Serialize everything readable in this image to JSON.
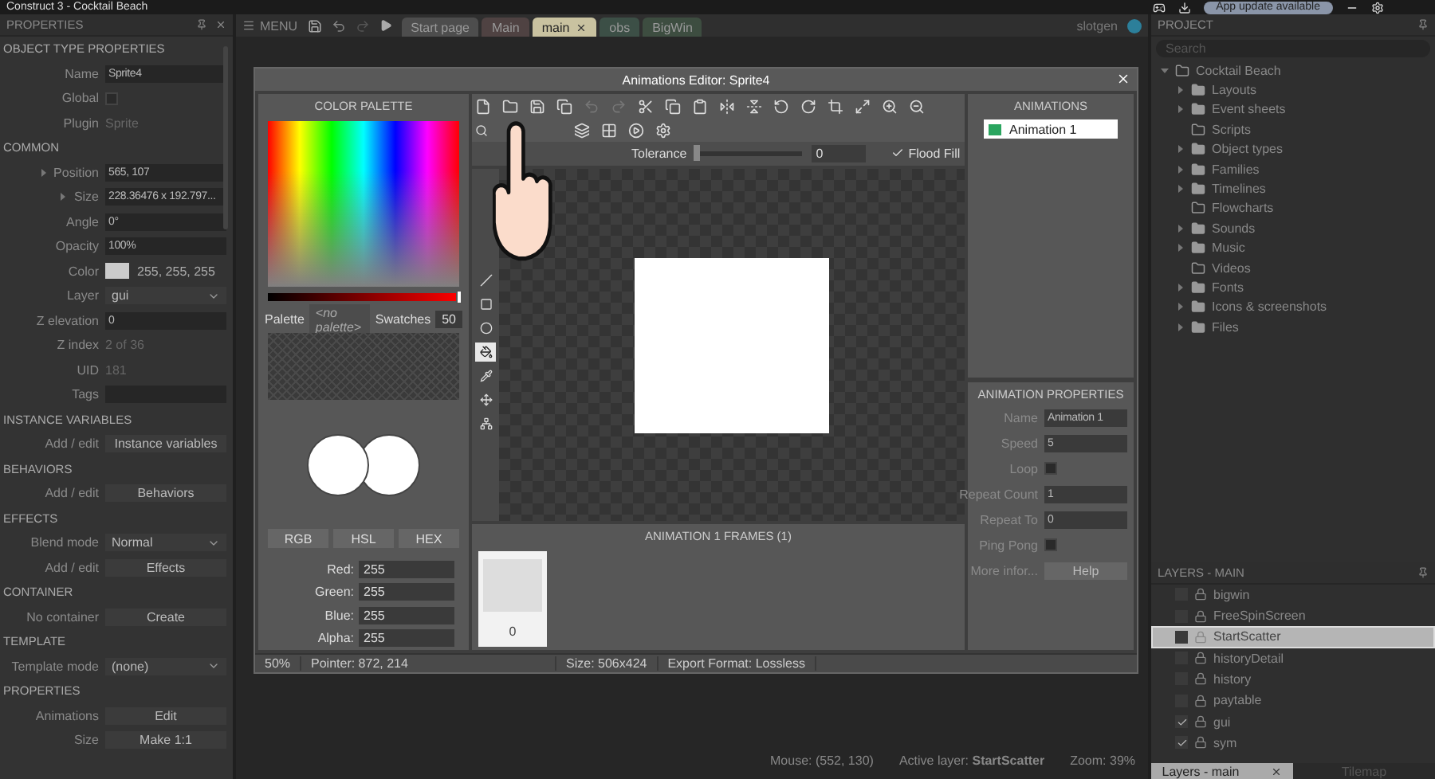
{
  "window": {
    "title": "Construct 3 - Cocktail Beach",
    "update_badge": "App update available"
  },
  "properties": {
    "title": "PROPERTIES",
    "sections": [
      {
        "title": "OBJECT TYPE PROPERTIES",
        "rows": [
          {
            "label": "Name",
            "kind": "input",
            "value": "Sprite4"
          },
          {
            "label": "Global",
            "kind": "checkbox",
            "checked": false
          },
          {
            "label": "Plugin",
            "kind": "text",
            "value": "Sprite"
          }
        ]
      },
      {
        "title": "COMMON",
        "rows": [
          {
            "label": "Position",
            "kind": "expand-input",
            "value": "565, 107"
          },
          {
            "label": "Size",
            "kind": "expand-input",
            "value": "228.36476 x 192.797..."
          },
          {
            "label": "Angle",
            "kind": "input",
            "value": "0°"
          },
          {
            "label": "Opacity",
            "kind": "input",
            "value": "100%"
          },
          {
            "label": "Color",
            "kind": "color",
            "value": "255, 255, 255"
          },
          {
            "label": "Layer",
            "kind": "select",
            "value": "gui"
          },
          {
            "label": "Z elevation",
            "kind": "input",
            "value": "0"
          },
          {
            "label": "Z index",
            "kind": "text",
            "value": "2 of 36"
          },
          {
            "label": "UID",
            "kind": "text",
            "value": "181"
          },
          {
            "label": "Tags",
            "kind": "input"
          }
        ]
      },
      {
        "title": "INSTANCE VARIABLES",
        "rows": [
          {
            "label": "Add / edit",
            "kind": "button",
            "value": "Instance variables"
          }
        ]
      },
      {
        "title": "BEHAVIORS",
        "rows": [
          {
            "label": "Add / edit",
            "kind": "button",
            "value": "Behaviors"
          }
        ]
      },
      {
        "title": "EFFECTS",
        "rows": [
          {
            "label": "Blend mode",
            "kind": "select",
            "value": "Normal"
          },
          {
            "label": "Add / edit",
            "kind": "button",
            "value": "Effects"
          }
        ]
      },
      {
        "title": "CONTAINER",
        "rows": [
          {
            "label": "No container",
            "kind": "button",
            "value": "Create"
          }
        ]
      },
      {
        "title": "TEMPLATE",
        "rows": [
          {
            "label": "Template mode",
            "kind": "select",
            "value": "(none)"
          }
        ]
      },
      {
        "title": "PROPERTIES",
        "rows": [
          {
            "label": "Animations",
            "kind": "button",
            "value": "Edit"
          },
          {
            "label": "Size",
            "kind": "button",
            "value": "Make 1:1"
          }
        ]
      }
    ]
  },
  "toolbar": {
    "menu": "MENU",
    "user": "slotgen"
  },
  "tabs": [
    {
      "label": "Start page",
      "selected": false,
      "color": "#4d4d4d"
    },
    {
      "label": "Main",
      "selected": false,
      "color": "#4f4242"
    },
    {
      "label": "main",
      "selected": true,
      "color": "#c9c2a0"
    },
    {
      "label": "obs",
      "selected": false,
      "color": "#3c4f46"
    },
    {
      "label": "BigWin",
      "selected": false,
      "color": "#3d4d40"
    }
  ],
  "editor": {
    "title": "Animations Editor: Sprite4",
    "palette": {
      "title": "COLOR PALETTE",
      "level": 1,
      "palette_label": "Palette",
      "palette_value": "<no palette>",
      "swatches_label": "Swatches",
      "swatches": "50",
      "modes": [
        "RGB",
        "HSL",
        "HEX"
      ],
      "channels": [
        {
          "label": "Red:",
          "value": "255"
        },
        {
          "label": "Green:",
          "value": "255"
        },
        {
          "label": "Blue:",
          "value": "255"
        },
        {
          "label": "Alpha:",
          "value": "255"
        }
      ]
    },
    "tolerance": {
      "label": "Tolerance",
      "value": "0",
      "level": 0
    },
    "flood_fill": {
      "label": "Flood Fill",
      "checked": true
    },
    "tools": [
      {
        "selected": false
      },
      {
        "selected": false
      },
      {
        "selected": false
      },
      {
        "selected": true
      },
      {
        "selected": false
      },
      {
        "selected": false
      },
      {
        "selected": false
      }
    ],
    "animations": {
      "title": "ANIMATIONS",
      "items": [
        {
          "name": "Animation 1",
          "selected": true
        }
      ]
    },
    "frames": {
      "title": "ANIMATION 1 FRAMES (1)",
      "items": [
        {
          "label": "0",
          "selected": true
        }
      ]
    },
    "animation_properties": {
      "title": "ANIMATION PROPERTIES",
      "rows": [
        {
          "label": "Name",
          "kind": "input",
          "value": "Animation 1"
        },
        {
          "label": "Speed",
          "kind": "input",
          "value": "5"
        },
        {
          "label": "Loop",
          "kind": "checkbox",
          "checked": false
        },
        {
          "label": "Repeat Count",
          "kind": "input",
          "value": "1"
        },
        {
          "label": "Repeat To",
          "kind": "input",
          "value": "0"
        },
        {
          "label": "Ping Pong",
          "kind": "checkbox",
          "checked": false
        },
        {
          "label": "More infor...",
          "kind": "button",
          "value": "Help"
        }
      ]
    },
    "status": {
      "zoom": "50%",
      "pointer": "Pointer: 872, 214",
      "size": "Size: 506x424",
      "format": "Export Format: Lossless"
    }
  },
  "status_bar": {
    "mouse": "Mouse: (552, 130)",
    "active_layer": "Active layer: **StartScatter**",
    "zoom": "Zoom: 39%"
  },
  "project": {
    "title": "PROJECT",
    "search_placeholder": "Search",
    "tree": {
      "label": "Cocktail Beach",
      "expanded": true,
      "children": [
        {
          "label": "Layouts",
          "expandable": true
        },
        {
          "label": "Event sheets",
          "expandable": true
        },
        {
          "label": "Scripts",
          "expandable": false
        },
        {
          "label": "Object types",
          "expandable": true
        },
        {
          "label": "Families",
          "expandable": true
        },
        {
          "label": "Timelines",
          "expandable": true
        },
        {
          "label": "Flowcharts",
          "expandable": false
        },
        {
          "label": "Sounds",
          "expandable": true
        },
        {
          "label": "Music",
          "expandable": true
        },
        {
          "label": "Videos",
          "expandable": false
        },
        {
          "label": "Fonts",
          "expandable": true
        },
        {
          "label": "Icons & screenshots",
          "expandable": true
        },
        {
          "label": "Files",
          "expandable": true
        }
      ]
    }
  },
  "layers": {
    "title": "LAYERS - MAIN",
    "items": [
      {
        "name": "bigwin",
        "visible": false,
        "selected": false
      },
      {
        "name": "FreeSpinScreen",
        "visible": false,
        "selected": false
      },
      {
        "name": "StartScatter",
        "visible": false,
        "selected": true
      },
      {
        "name": "historyDetail",
        "visible": false,
        "selected": false
      },
      {
        "name": "history",
        "visible": false,
        "selected": false
      },
      {
        "name": "paytable",
        "visible": false,
        "selected": false
      },
      {
        "name": "gui",
        "visible": true,
        "selected": false
      },
      {
        "name": "sym",
        "visible": true,
        "selected": false
      }
    ],
    "tabs": [
      {
        "label": "Layers - main",
        "selected": true
      },
      {
        "label": "Tilemap",
        "selected": false
      }
    ]
  }
}
